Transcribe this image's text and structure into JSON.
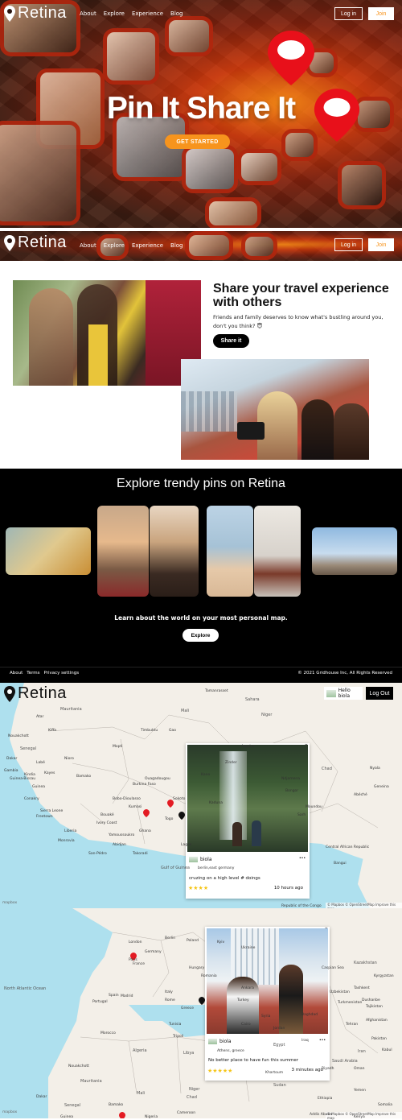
{
  "brand": {
    "name": "Retina"
  },
  "nav": {
    "links": [
      "About",
      "Explore",
      "Experience",
      "Blog"
    ],
    "login_label": "Log in",
    "join_label": "Join"
  },
  "hero": {
    "title": "Pin It Share It",
    "cta_label": "GET STARTED"
  },
  "share": {
    "title": "Share your travel experience with others",
    "subtitle": "Friends and family deserves to know what's bustling around you, don't you think? 😇",
    "button_label": "Share it"
  },
  "explore": {
    "title": "Explore trendy pins on Retina",
    "subtitle": "Learn about the world on your most personal map.",
    "button_label": "Explore"
  },
  "footer": {
    "links": [
      "About",
      "Terms",
      "Privacy settings"
    ],
    "copyright": "© 2021 Gridhouse Inc, All Rights Reserved"
  },
  "map_header": {
    "greeting": "Hello biola",
    "logout_label": "Log Out"
  },
  "map1": {
    "labels": [
      "Tamanrasset",
      "Sahara",
      "Mauritania",
      "Mali",
      "Niger",
      "Chad",
      "Senegal",
      "Nioro",
      "Kayes",
      "Bamako",
      "Burkina Faso",
      "Guinea",
      "Sierra Leone",
      "Liberia",
      "Ivory Coast",
      "Ghana",
      "Togo",
      "Lagos",
      "Abidjan",
      "Dakar",
      "Gambia",
      "Guinea-Bissau",
      "Conakry",
      "Freetown",
      "Monrovia",
      "Yamoussoukro",
      "San-Pédro",
      "Takoradi",
      "Kumasi",
      "Central African Republic",
      "Bangui",
      "Nyala",
      "Ndjamena",
      "Bongor",
      "Sarh",
      "Moundou",
      "Abéché",
      "Geneina",
      "Gulf of Guinea",
      "Republic of the Congo",
      "Bouaké",
      "Bobo-Dioulasso",
      "Ouagadougou",
      "Kano",
      "Zinder",
      "Agadez",
      "Mopti",
      "Timbuktu",
      "Gao",
      "Kiffa",
      "Atar",
      "Nouakchott",
      "Sokoto",
      "Kaduna",
      "Kindia",
      "Labé"
    ],
    "popup": {
      "user": "biola",
      "location": "berlin,east germany",
      "caption": "cruzing on a high level # doings",
      "rating": 4,
      "time": "10 hours ago"
    },
    "attribution": "© Mapbox © OpenStreetMap Improve this map",
    "mapbox": "mapbox"
  },
  "map2": {
    "labels": [
      "Berlin",
      "Poland",
      "Germany",
      "France",
      "Ukraine",
      "Spain",
      "Portugal",
      "Italy",
      "Algeria",
      "Morocco",
      "Tunisia",
      "Libya",
      "Egypt",
      "Mauritania",
      "Mali",
      "Niger",
      "Chad",
      "Sudan",
      "Kazakhstan",
      "Uzbekistan",
      "Turkmenistan",
      "Afghanistan",
      "Pakistan",
      "Iran",
      "Iraq",
      "Saudi Arabia",
      "Oman",
      "Yemen",
      "Ethiopia",
      "Somalia",
      "Kenya",
      "North Atlantic Ocean",
      "Paris",
      "Madrid",
      "Rome",
      "London",
      "Kyiv",
      "Hungary",
      "Romania",
      "Greece",
      "Turkey",
      "Syria",
      "Jordan",
      "Caspian Sea",
      "Dakar",
      "Senegal",
      "Guinea",
      "Nigeria",
      "Cameroon",
      "Addis Ababa",
      "Kabul",
      "Tashkent",
      "Dushanbe",
      "Tajikistan",
      "Kyrgyzstan",
      "Nouakchott",
      "Bamako",
      "Tripoli",
      "Cairo",
      "Riyadh",
      "Tehran",
      "Baghdad",
      "Ankara",
      "Khartoum"
    ],
    "popup": {
      "user": "biola",
      "location": "Athens, greece",
      "caption": "No better place to have fun this summer",
      "rating": 5,
      "time": "3 minutes ago"
    },
    "attribution": "© Mapbox © OpenStreetMap Improve this map",
    "mapbox": "mapbox"
  }
}
